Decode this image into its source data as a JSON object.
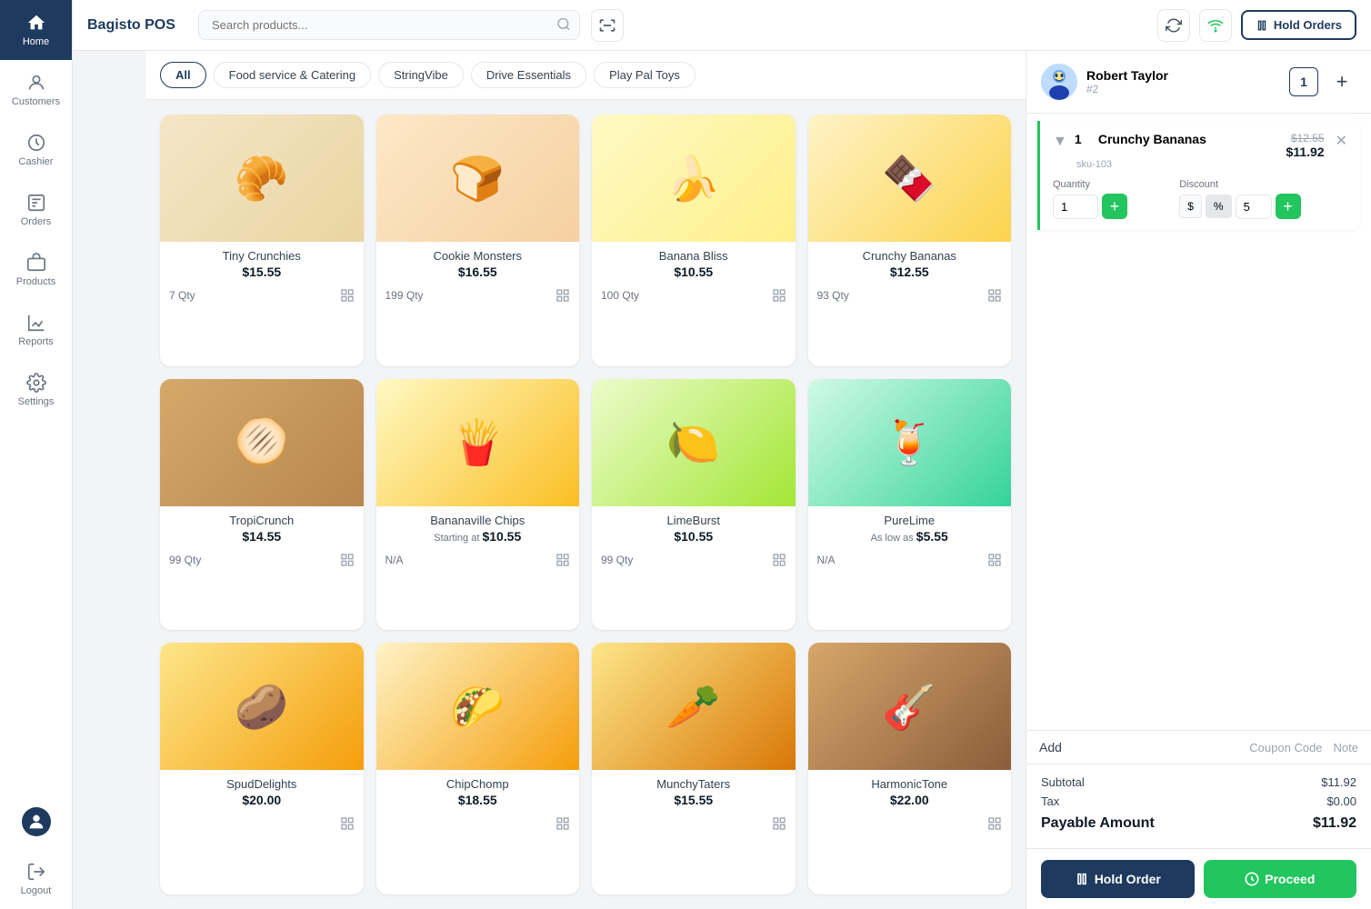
{
  "app": {
    "title": "Bagisto POS"
  },
  "topbar": {
    "search_placeholder": "Search products...",
    "hold_orders_label": "Hold Orders"
  },
  "categories": [
    {
      "id": "all",
      "label": "All",
      "active": true
    },
    {
      "id": "food-catering",
      "label": "Food service & Catering",
      "active": false
    },
    {
      "id": "stringvibe",
      "label": "StringVibe",
      "active": false
    },
    {
      "id": "drive-essentials",
      "label": "Drive Essentials",
      "active": false
    },
    {
      "id": "play-pal-toys",
      "label": "Play Pal Toys",
      "active": false
    }
  ],
  "products": [
    {
      "id": 1,
      "name": "Tiny Crunchies",
      "price": "$15.55",
      "qty": "7 Qty",
      "emoji": "🥐"
    },
    {
      "id": 2,
      "name": "Cookie Monsters",
      "price": "$16.55",
      "qty": "199 Qty",
      "emoji": "🍞"
    },
    {
      "id": 3,
      "name": "Banana Bliss",
      "price": "$10.55",
      "qty": "100 Qty",
      "emoji": "🍌"
    },
    {
      "id": 4,
      "name": "Crunchy Bananas",
      "price": "$12.55",
      "qty": "93 Qty",
      "emoji": "🍫"
    },
    {
      "id": 5,
      "name": "TropiCrunch",
      "price": "$14.55",
      "qty": "99 Qty",
      "emoji": "🫓"
    },
    {
      "id": 6,
      "name": "Bananaville Chips",
      "price": "$10.55",
      "price_prefix": "Starting at",
      "qty": "N/A",
      "emoji": "🍟"
    },
    {
      "id": 7,
      "name": "LimeBurst",
      "price": "$10.55",
      "qty": "99 Qty",
      "emoji": "🍋"
    },
    {
      "id": 8,
      "name": "PureLime",
      "price": "$5.55",
      "price_prefix": "As low as",
      "qty": "N/A",
      "emoji": "🍹"
    },
    {
      "id": 9,
      "name": "SpudDelights",
      "price": "$20.00",
      "qty": "",
      "emoji": "🥔"
    },
    {
      "id": 10,
      "name": "ChipChomp",
      "price": "$18.55",
      "qty": "",
      "emoji": "🌮"
    },
    {
      "id": 11,
      "name": "MunchyTaters",
      "price": "$15.55",
      "qty": "",
      "emoji": "🥕"
    },
    {
      "id": 12,
      "name": "HarmonicTone",
      "price": "$22.00",
      "qty": "",
      "emoji": "🎸"
    }
  ],
  "sidebar": {
    "items": [
      {
        "id": "home",
        "label": "Home",
        "active": true
      },
      {
        "id": "customers",
        "label": "Customers",
        "active": false
      },
      {
        "id": "cashier",
        "label": "Cashier",
        "active": false
      },
      {
        "id": "orders",
        "label": "Orders",
        "active": false
      },
      {
        "id": "products",
        "label": "Products",
        "active": false
      },
      {
        "id": "reports",
        "label": "Reports",
        "active": false
      },
      {
        "id": "settings",
        "label": "Settings",
        "active": false
      },
      {
        "id": "profile",
        "label": "",
        "active": false
      },
      {
        "id": "logout",
        "label": "Logout",
        "active": false
      }
    ]
  },
  "cart": {
    "customer_name": "Robert Taylor",
    "customer_id": "#2",
    "order_count": "1",
    "items": [
      {
        "id": 1,
        "qty": "1",
        "name": "Crunchy Bananas",
        "sku": "sku-103",
        "original_price": "$12.55",
        "final_price": "$11.92",
        "quantity_value": "1",
        "discount_type_dollar": "$",
        "discount_type_percent": "%",
        "discount_value": "5"
      }
    ],
    "add_label": "Add",
    "coupon_code_label": "Coupon Code",
    "note_label": "Note",
    "subtotal_label": "Subtotal",
    "subtotal_value": "$11.92",
    "tax_label": "Tax",
    "tax_value": "$0.00",
    "payable_label": "Payable Amount",
    "payable_value": "$11.92",
    "hold_order_label": "Hold Order",
    "proceed_label": "Proceed"
  }
}
